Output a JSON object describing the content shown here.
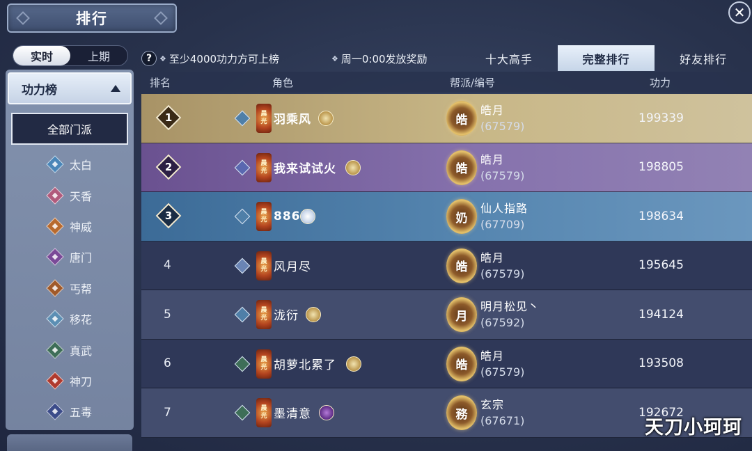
{
  "header": {
    "title": "排行"
  },
  "period_toggle": {
    "options": [
      "实时",
      "上期"
    ],
    "active": 0
  },
  "board": {
    "label": "功力榜"
  },
  "factions": {
    "all_label": "全部门派",
    "items": [
      "太白",
      "天香",
      "神威",
      "唐门",
      "丐帮",
      "移花",
      "真武",
      "神刀",
      "五毒"
    ]
  },
  "notices": {
    "help": "?",
    "n1": "至少4000功力方可上榜",
    "n2": "周一0:00发放奖励"
  },
  "tabs": [
    "十大高手",
    "完整排行",
    "好友排行"
  ],
  "table": {
    "headers": {
      "rank": "排名",
      "role": "角色",
      "guild": "帮派/编号",
      "power": "功力"
    },
    "rows": [
      {
        "rank": "1",
        "name": "羽乘风",
        "guild_char": "皓",
        "guild": "皓月",
        "id": "(67579)",
        "power": "199339"
      },
      {
        "rank": "2",
        "name": "我来试试火",
        "guild_char": "皓",
        "guild": "皓月",
        "id": "(67579)",
        "power": "198805"
      },
      {
        "rank": "3",
        "name": "886",
        "guild_char": "奶",
        "guild": "仙人指路",
        "id": "(67709)",
        "power": "198634"
      },
      {
        "rank": "4",
        "name": "风月尽",
        "guild_char": "皓",
        "guild": "皓月",
        "id": "(67579)",
        "power": "195645"
      },
      {
        "rank": "5",
        "name": "泷衍",
        "guild_char": "月",
        "guild": "明月松见丶",
        "id": "(67592)",
        "power": "194124"
      },
      {
        "rank": "6",
        "name": "胡萝北累了",
        "guild_char": "皓",
        "guild": "皓月",
        "id": "(67579)",
        "power": "193508"
      },
      {
        "rank": "7",
        "name": "墨清意",
        "guild_char": "務",
        "guild": "玄宗",
        "id": "(67671)",
        "power": "192672"
      }
    ],
    "title_badge_text": "晨光"
  },
  "watermark": "天刀小珂珂",
  "colors": {
    "accent_tab": "#d6e2f0",
    "gold_row": "#c8b787",
    "purple_row": "#8672ad",
    "blue_row": "#5686b0"
  }
}
